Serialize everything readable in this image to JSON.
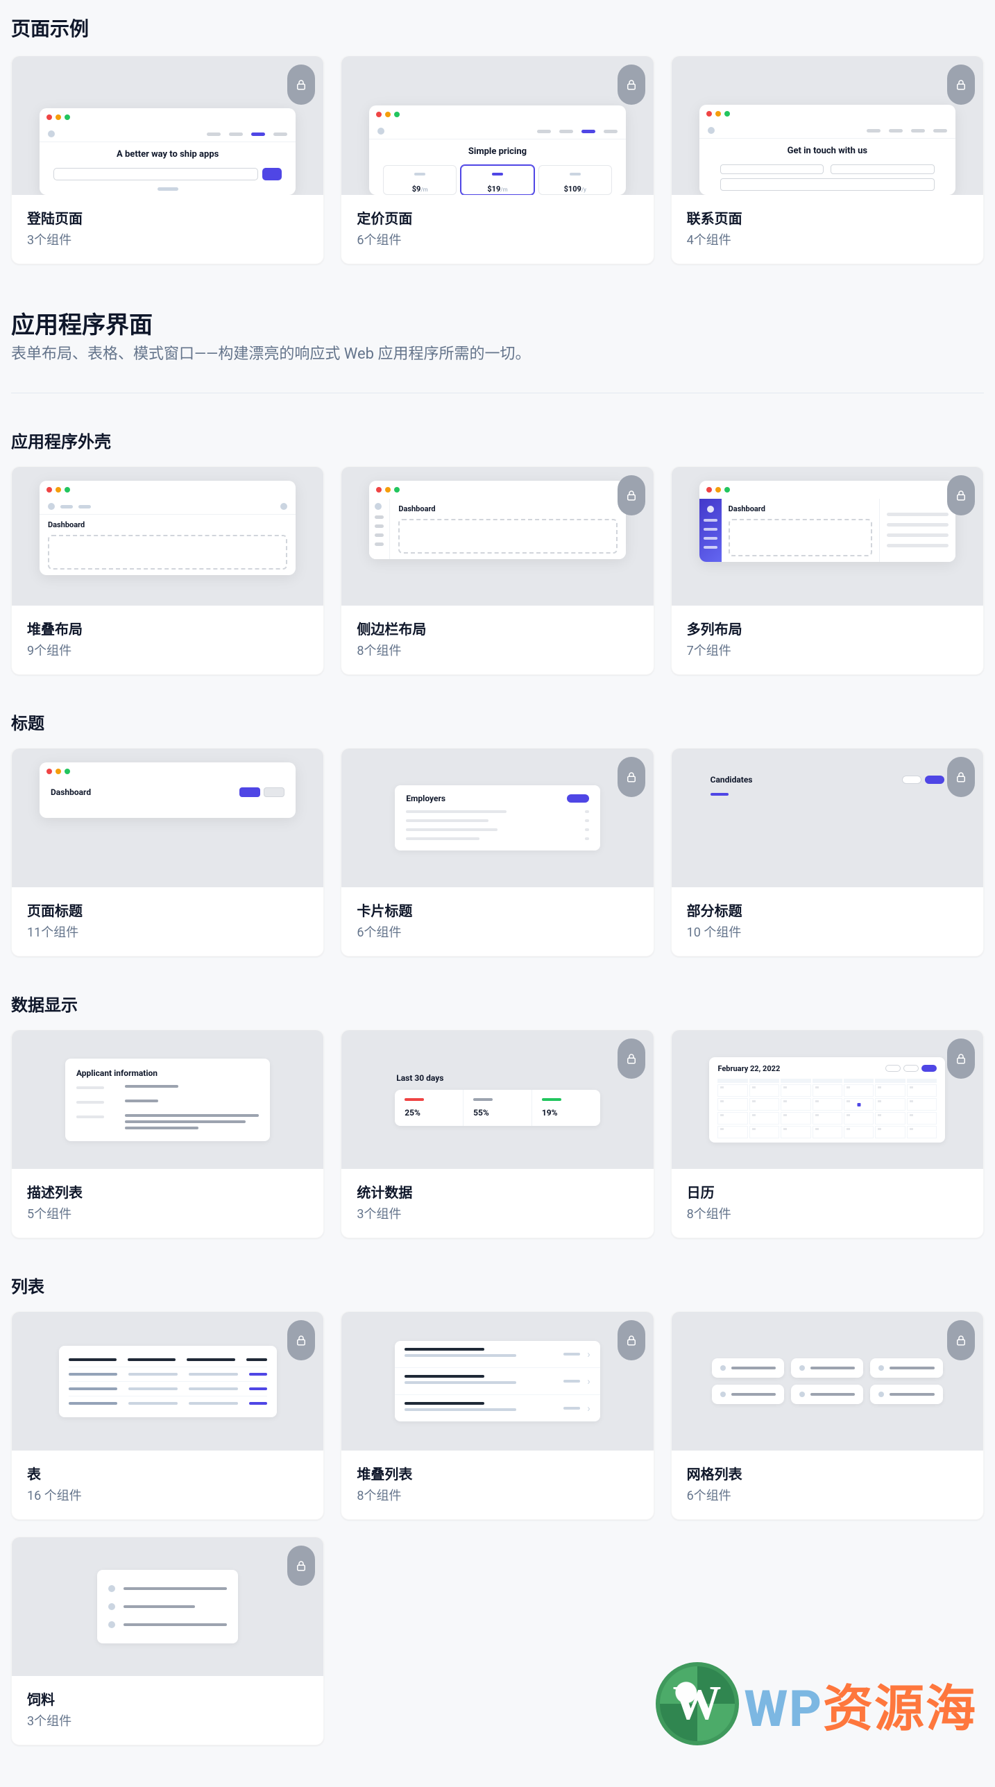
{
  "sections": {
    "page_examples": {
      "title": "页面示例"
    },
    "app_ui": {
      "title": "应用程序界面",
      "desc": "表单布局、表格、模式窗口——构建漂亮的响应式 Web 应用程序所需的一切。"
    },
    "app_shell": {
      "title": "应用程序外壳"
    },
    "headings": {
      "title": "标题"
    },
    "data_display": {
      "title": "数据显示"
    },
    "lists": {
      "title": "列表"
    }
  },
  "cards": {
    "landing": {
      "title": "登陆页面",
      "count": "3个组件",
      "headline": "A better way to ship apps"
    },
    "pricing": {
      "title": "定价页面",
      "count": "6个组件",
      "headline": "Simple pricing",
      "plans": [
        {
          "amt": "$9",
          "per": "/m"
        },
        {
          "amt": "$19",
          "per": "/m"
        },
        {
          "amt": "$109",
          "per": "/y"
        }
      ]
    },
    "contact": {
      "title": "联系页面",
      "count": "4个组件",
      "headline": "Get in touch with us"
    },
    "stack": {
      "title": "堆叠布局",
      "count": "9个组件",
      "label": "Dashboard"
    },
    "sidebar": {
      "title": "侧边栏布局",
      "count": "8个组件",
      "label": "Dashboard"
    },
    "multicol": {
      "title": "多列布局",
      "count": "7个组件",
      "label": "Dashboard"
    },
    "pagehead": {
      "title": "页面标题",
      "count": "11个组件",
      "label": "Dashboard"
    },
    "cardhead": {
      "title": "卡片标题",
      "count": "6个组件",
      "label": "Employers"
    },
    "sechead": {
      "title": "部分标题",
      "count": "10 个组件",
      "label": "Candidates"
    },
    "desclist": {
      "title": "描述列表",
      "count": "5个组件",
      "label": "Applicant information"
    },
    "stats": {
      "title": "统计数据",
      "count": "3个组件",
      "label": "Last 30 days",
      "items": [
        {
          "color": "#ef4444",
          "v": "25%"
        },
        {
          "color": "#1f2937",
          "v": "55%"
        },
        {
          "color": "#22c55e",
          "v": "19%"
        }
      ]
    },
    "calendar": {
      "title": "日历",
      "count": "8个组件",
      "label": "February 22, 2022"
    },
    "table": {
      "title": "表",
      "count": "16 个组件"
    },
    "stacklist": {
      "title": "堆叠列表",
      "count": "8个组件"
    },
    "gridlist": {
      "title": "网格列表",
      "count": "6个组件"
    },
    "feed": {
      "title": "饲料",
      "count": "3个组件"
    }
  },
  "watermark": {
    "letter": "W",
    "wp": "WP",
    "zh": "资源海"
  }
}
